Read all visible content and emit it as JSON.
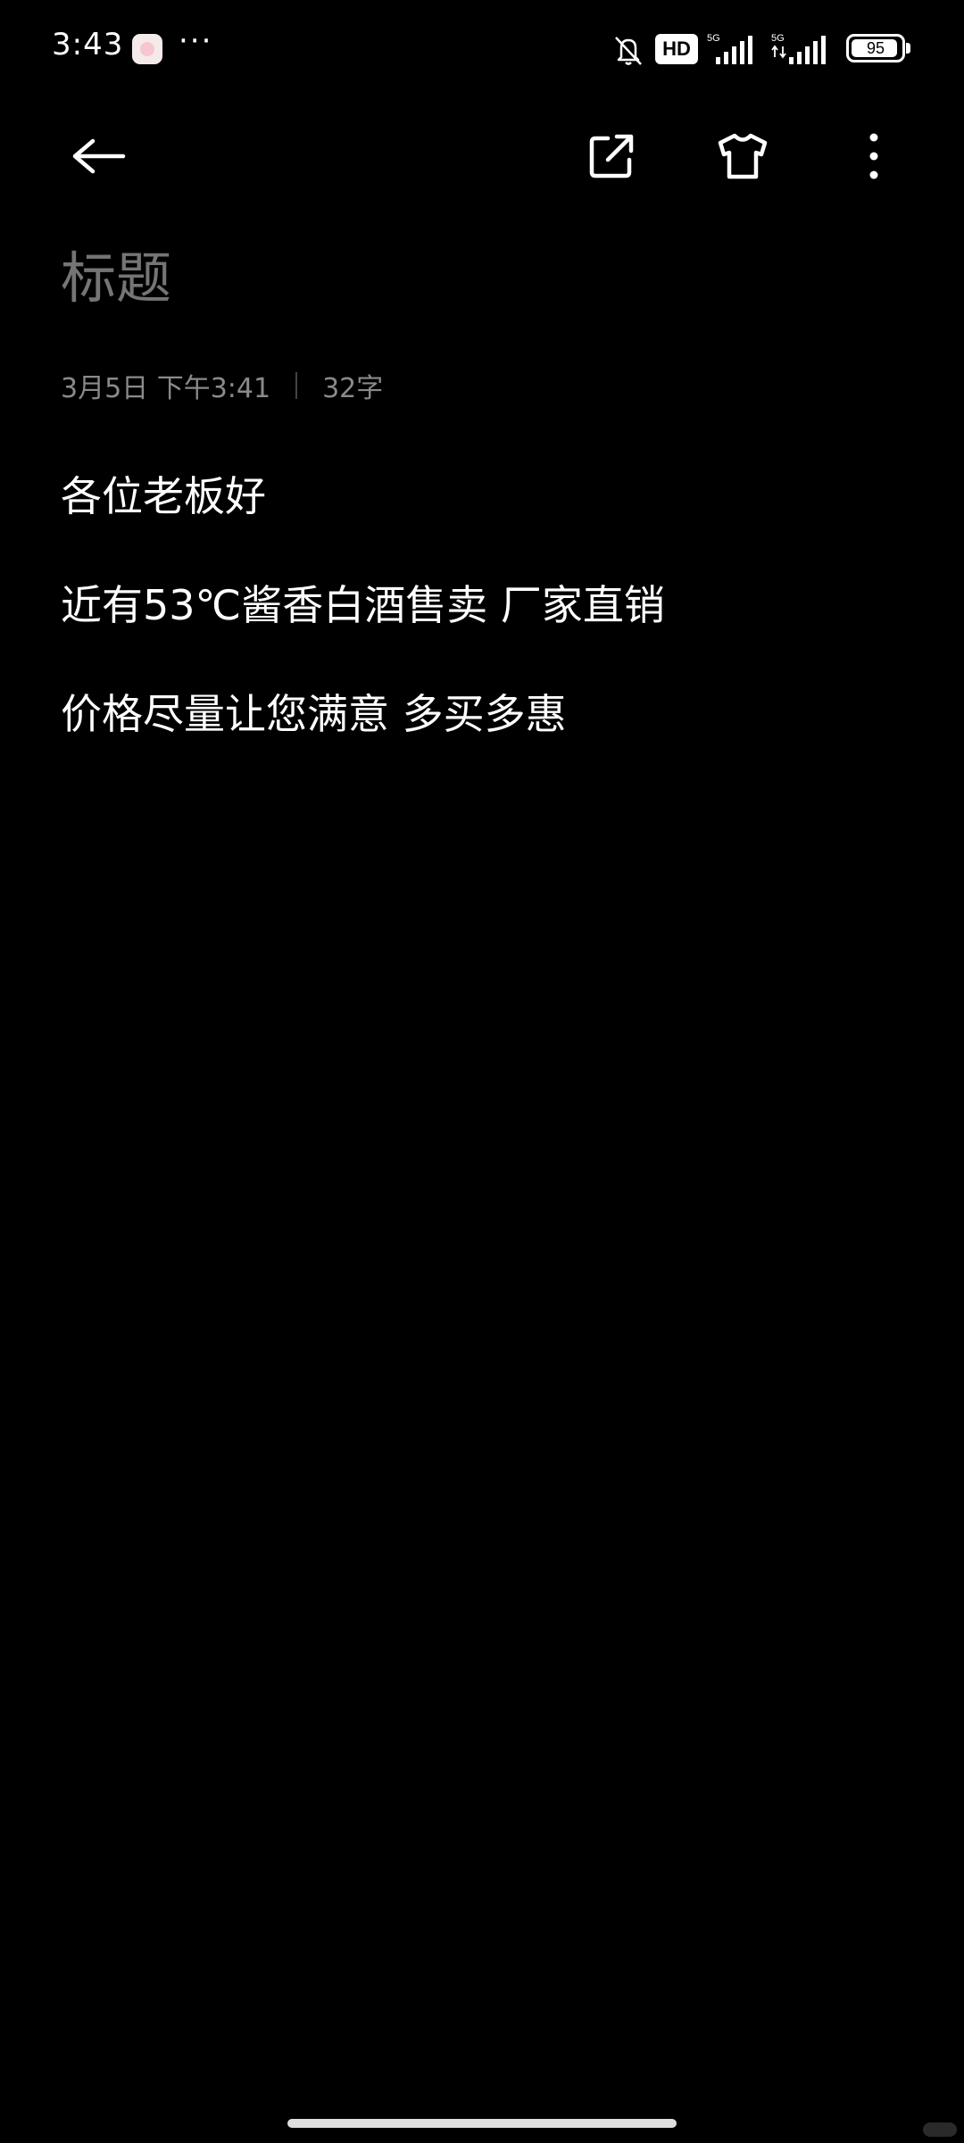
{
  "status_bar": {
    "time": "3:43",
    "more": "···",
    "hd_badge": "HD",
    "battery_level": "95",
    "battery_fraction": 0.95,
    "icons": [
      "app-notification-icon",
      "mute-bell-icon",
      "signal-5g-icon",
      "signal-5g-icon",
      "battery-icon"
    ]
  },
  "toolbar": {
    "icons": [
      "back-arrow-icon",
      "share-export-icon",
      "theme-shirt-icon",
      "more-vertical-icon"
    ]
  },
  "note": {
    "title_placeholder": "标题",
    "date": "3月5日 下午3:41",
    "word_count": "32字",
    "lines": [
      "各位老板好",
      "近有53℃酱香白酒售卖 厂家直销",
      "价格尽量让您满意 多买多惠"
    ]
  },
  "colors": {
    "background": "#000000",
    "text": "#ffffff",
    "placeholder": "#3a3a3a",
    "meta": "#8a8a8a"
  }
}
